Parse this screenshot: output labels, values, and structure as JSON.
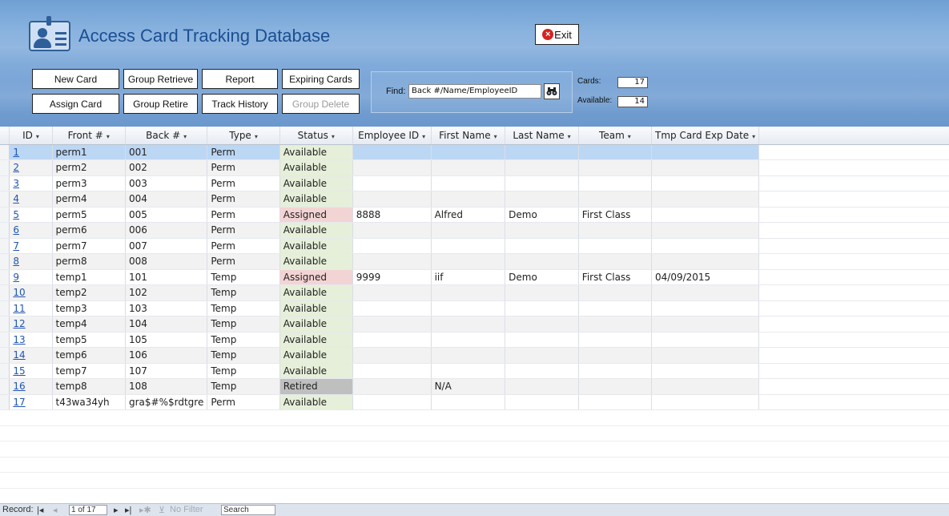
{
  "app": {
    "title": "Access Card Tracking Database",
    "exit_label": "Exit"
  },
  "toolbar": {
    "new_card": "New Card",
    "group_retrieve": "Group Retrieve",
    "report": "Report",
    "expiring_cards": "Expiring Cards",
    "assign_card": "Assign Card",
    "group_retire": "Group Retire",
    "track_history": "Track History",
    "group_delete": "Group Delete"
  },
  "find": {
    "label": "Find:",
    "value": "Back #/Name/EmployeeID"
  },
  "stats": {
    "cards_label": "Cards:",
    "cards_value": "17",
    "available_label": "Available:",
    "available_value": "14"
  },
  "columns": [
    "ID",
    "Front #",
    "Back #",
    "Type",
    "Status",
    "Employee ID",
    "First Name",
    "Last Name",
    "Team",
    "Tmp Card Exp Date"
  ],
  "rows": [
    {
      "id": "1",
      "front": "perm1",
      "back": "001",
      "type": "Perm",
      "status": "Available",
      "emp": "",
      "first": "",
      "last": "",
      "team": "",
      "exp": ""
    },
    {
      "id": "2",
      "front": "perm2",
      "back": "002",
      "type": "Perm",
      "status": "Available",
      "emp": "",
      "first": "",
      "last": "",
      "team": "",
      "exp": ""
    },
    {
      "id": "3",
      "front": "perm3",
      "back": "003",
      "type": "Perm",
      "status": "Available",
      "emp": "",
      "first": "",
      "last": "",
      "team": "",
      "exp": ""
    },
    {
      "id": "4",
      "front": "perm4",
      "back": "004",
      "type": "Perm",
      "status": "Available",
      "emp": "",
      "first": "",
      "last": "",
      "team": "",
      "exp": ""
    },
    {
      "id": "5",
      "front": "perm5",
      "back": "005",
      "type": "Perm",
      "status": "Assigned",
      "emp": "8888",
      "first": "Alfred",
      "last": "Demo",
      "team": "First Class",
      "exp": ""
    },
    {
      "id": "6",
      "front": "perm6",
      "back": "006",
      "type": "Perm",
      "status": "Available",
      "emp": "",
      "first": "",
      "last": "",
      "team": "",
      "exp": ""
    },
    {
      "id": "7",
      "front": "perm7",
      "back": "007",
      "type": "Perm",
      "status": "Available",
      "emp": "",
      "first": "",
      "last": "",
      "team": "",
      "exp": ""
    },
    {
      "id": "8",
      "front": "perm8",
      "back": "008",
      "type": "Perm",
      "status": "Available",
      "emp": "",
      "first": "",
      "last": "",
      "team": "",
      "exp": ""
    },
    {
      "id": "9",
      "front": "temp1",
      "back": "101",
      "type": "Temp",
      "status": "Assigned",
      "emp": "9999",
      "first": "iif",
      "last": "Demo",
      "team": "First Class",
      "exp": "04/09/2015"
    },
    {
      "id": "10",
      "front": "temp2",
      "back": "102",
      "type": "Temp",
      "status": "Available",
      "emp": "",
      "first": "",
      "last": "",
      "team": "",
      "exp": ""
    },
    {
      "id": "11",
      "front": "temp3",
      "back": "103",
      "type": "Temp",
      "status": "Available",
      "emp": "",
      "first": "",
      "last": "",
      "team": "",
      "exp": ""
    },
    {
      "id": "12",
      "front": "temp4",
      "back": "104",
      "type": "Temp",
      "status": "Available",
      "emp": "",
      "first": "",
      "last": "",
      "team": "",
      "exp": ""
    },
    {
      "id": "13",
      "front": "temp5",
      "back": "105",
      "type": "Temp",
      "status": "Available",
      "emp": "",
      "first": "",
      "last": "",
      "team": "",
      "exp": ""
    },
    {
      "id": "14",
      "front": "temp6",
      "back": "106",
      "type": "Temp",
      "status": "Available",
      "emp": "",
      "first": "",
      "last": "",
      "team": "",
      "exp": ""
    },
    {
      "id": "15",
      "front": "temp7",
      "back": "107",
      "type": "Temp",
      "status": "Available",
      "emp": "",
      "first": "",
      "last": "",
      "team": "",
      "exp": ""
    },
    {
      "id": "16",
      "front": "temp8",
      "back": "108",
      "type": "Temp",
      "status": "Retired",
      "emp": "",
      "first": "N/A",
      "last": "",
      "team": "",
      "exp": ""
    },
    {
      "id": "17",
      "front": "t43wa34yh",
      "back": "gra$#%$rdtgre",
      "type": "Perm",
      "status": "Available",
      "emp": "",
      "first": "",
      "last": "",
      "team": "",
      "exp": ""
    }
  ],
  "navbar": {
    "record_label": "Record:",
    "record_value": "1 of 17",
    "no_filter": "No Filter",
    "search": "Search"
  },
  "colors": {
    "available": "#e6efd9",
    "assigned": "#f3d4d4",
    "retired": "#bfbfbf",
    "selected_row": "#bcd7f4",
    "title_blue": "#1b4f92"
  }
}
